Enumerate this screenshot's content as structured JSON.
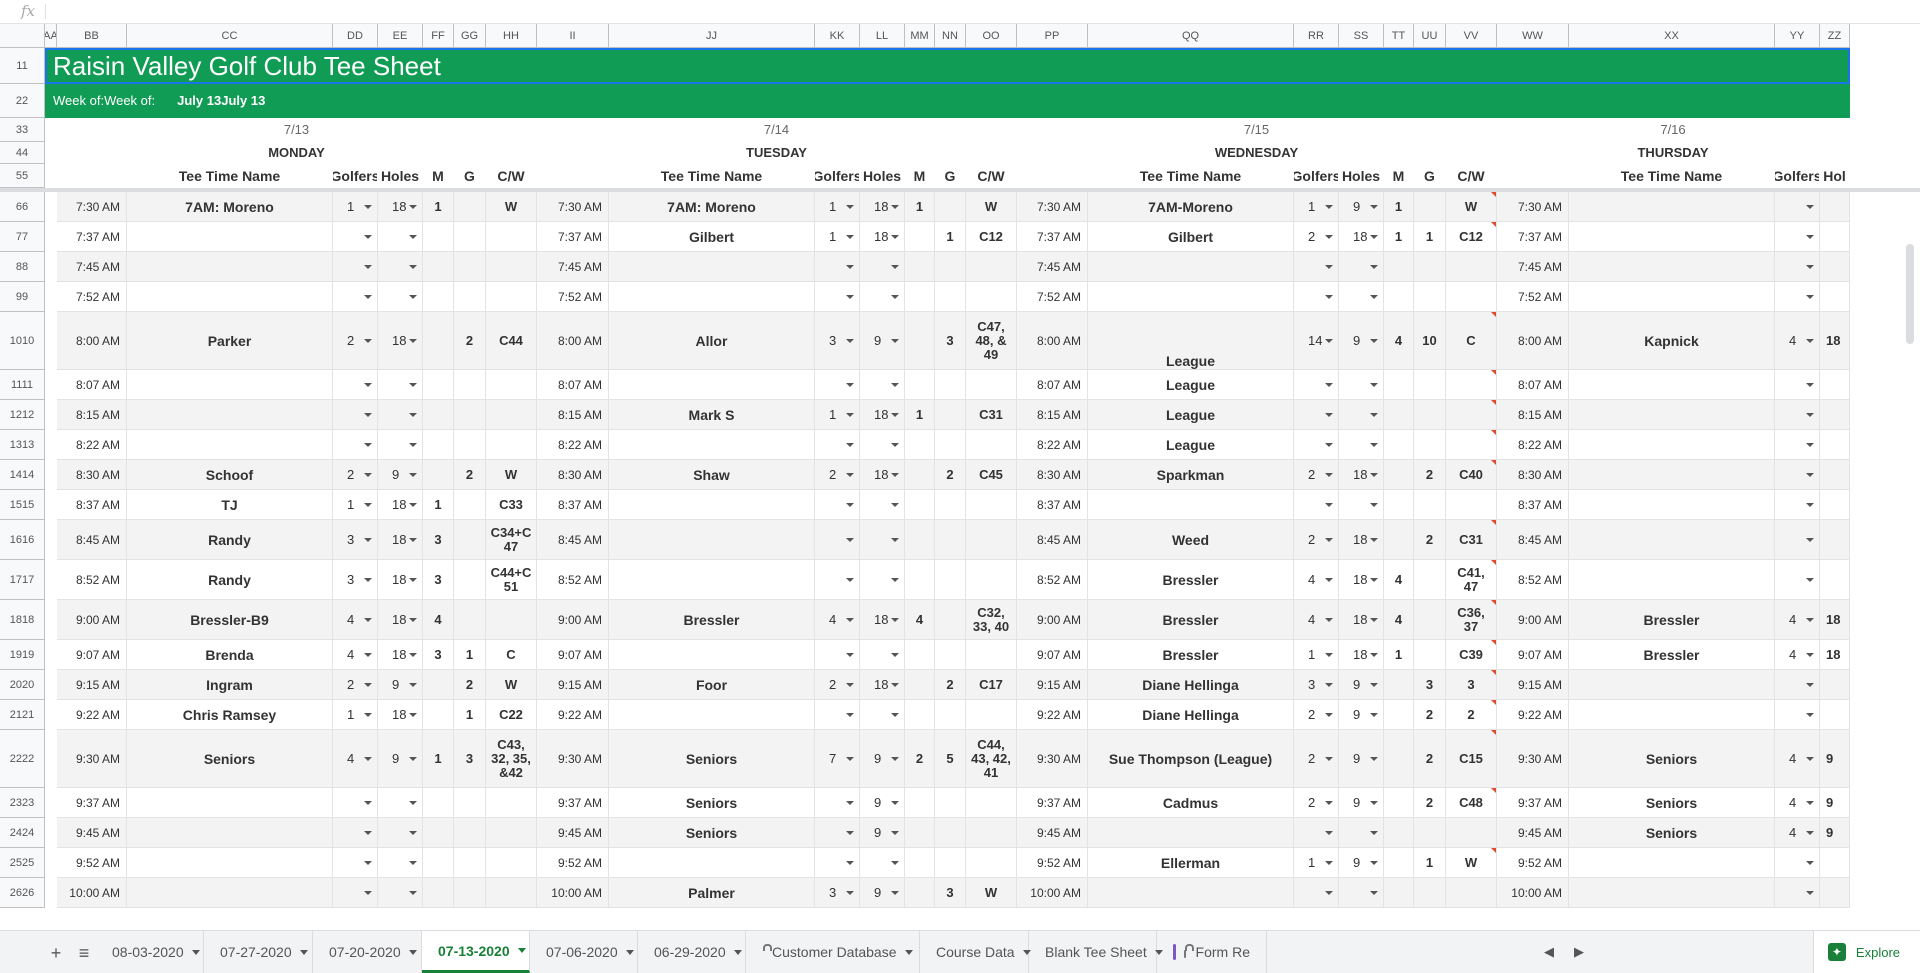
{
  "formula_bar": {
    "fx_label": "fx"
  },
  "columns": [
    "",
    "A",
    "B",
    "C",
    "D",
    "E",
    "F",
    "G",
    "H",
    "I",
    "J",
    "K",
    "L",
    "M",
    "N",
    "O",
    "P",
    "Q",
    "R",
    "S",
    "T",
    "U",
    "V",
    "W",
    "X",
    "Y",
    "Z"
  ],
  "rows": [
    1,
    2,
    3,
    4,
    5,
    6,
    7,
    8,
    9,
    10,
    11,
    12,
    13,
    14,
    15,
    16,
    17,
    18,
    19,
    20,
    21,
    22,
    23,
    24,
    25,
    26
  ],
  "sheet": {
    "title": "Raisin Valley Golf Club Tee Sheet",
    "week_of_label": "Week of:",
    "week_of_value": "July 13",
    "header_color": "#119c55",
    "days": [
      {
        "date": "7/13",
        "name": "MONDAY"
      },
      {
        "date": "7/14",
        "name": "TUESDAY"
      },
      {
        "date": "7/15",
        "name": "WEDNESDAY"
      },
      {
        "date": "7/16",
        "name": "THURSDAY"
      }
    ],
    "col_labels": {
      "name": "Tee Time Name",
      "golfers": "Golfers",
      "holes": "Holes",
      "m": "M",
      "g": "G",
      "cw": "C/W",
      "holes_cut": "Hol"
    }
  },
  "times": [
    "7:30 AM",
    "7:37 AM",
    "7:45 AM",
    "7:52 AM",
    "8:00 AM",
    "8:07 AM",
    "8:15 AM",
    "8:22 AM",
    "8:30 AM",
    "8:37 AM",
    "8:45 AM",
    "8:52 AM",
    "9:00 AM",
    "9:07 AM",
    "9:15 AM",
    "9:22 AM",
    "9:30 AM",
    "9:37 AM",
    "9:45 AM",
    "9:52 AM",
    "10:00 AM"
  ],
  "schedule": {
    "monday": [
      [
        "7AM: Moreno",
        "1",
        "18",
        "1",
        "",
        "W"
      ],
      [
        "",
        "",
        "",
        "",
        "",
        ""
      ],
      [
        "",
        "",
        "",
        "",
        "",
        ""
      ],
      [
        "",
        "",
        "",
        "",
        "",
        ""
      ],
      [
        "Parker",
        "2",
        "18",
        "",
        "2",
        "C44"
      ],
      [
        "",
        "",
        "",
        "",
        "",
        ""
      ],
      [
        "",
        "",
        "",
        "",
        "",
        ""
      ],
      [
        "",
        "",
        "",
        "",
        "",
        ""
      ],
      [
        "Schoof",
        "2",
        "9",
        "",
        "2",
        "W"
      ],
      [
        "TJ",
        "1",
        "18",
        "1",
        "",
        "C33"
      ],
      [
        "Randy",
        "3",
        "18",
        "3",
        "",
        "C34+C 47"
      ],
      [
        "Randy",
        "3",
        "18",
        "3",
        "",
        "C44+C 51"
      ],
      [
        "Bressler-B9",
        "4",
        "18",
        "4",
        "",
        ""
      ],
      [
        "Brenda",
        "4",
        "18",
        "3",
        "1",
        "C"
      ],
      [
        "Ingram",
        "2",
        "9",
        "",
        "2",
        "W"
      ],
      [
        "Chris Ramsey",
        "1",
        "18",
        "",
        "1",
        "C22"
      ],
      [
        "Seniors",
        "4",
        "9",
        "1",
        "3",
        "C43, 32, 35, &42"
      ],
      [
        "",
        "",
        "",
        "",
        "",
        ""
      ],
      [
        "",
        "",
        "",
        "",
        "",
        ""
      ],
      [
        "",
        "",
        "",
        "",
        "",
        ""
      ],
      [
        "",
        "",
        "",
        "",
        "",
        ""
      ]
    ],
    "tuesday": [
      [
        "7AM: Moreno",
        "1",
        "18",
        "1",
        "",
        "W"
      ],
      [
        "Gilbert",
        "1",
        "18",
        "",
        "1",
        "C12"
      ],
      [
        "",
        "",
        "",
        "",
        "",
        ""
      ],
      [
        "",
        "",
        "",
        "",
        "",
        ""
      ],
      [
        "Allor",
        "3",
        "9",
        "",
        "3",
        "C47, 48, & 49"
      ],
      [
        "",
        "",
        "",
        "",
        "",
        ""
      ],
      [
        "Mark S",
        "1",
        "18",
        "1",
        "",
        "C31"
      ],
      [
        "",
        "",
        "",
        "",
        "",
        ""
      ],
      [
        "Shaw",
        "2",
        "18",
        "",
        "2",
        "C45"
      ],
      [
        "",
        "",
        "",
        "",
        "",
        ""
      ],
      [
        "",
        "",
        "",
        "",
        "",
        ""
      ],
      [
        "",
        "",
        "",
        "",
        "",
        ""
      ],
      [
        "Bressler",
        "4",
        "18",
        "4",
        "",
        "C32, 33, 40"
      ],
      [
        "",
        "",
        "",
        "",
        "",
        ""
      ],
      [
        "Foor",
        "2",
        "18",
        "",
        "2",
        "C17"
      ],
      [
        "",
        "",
        "",
        "",
        "",
        ""
      ],
      [
        "Seniors",
        "7",
        "9",
        "2",
        "5",
        "C44, 43, 42, 41"
      ],
      [
        "Seniors",
        "",
        "9",
        "",
        "",
        ""
      ],
      [
        "Seniors",
        "",
        "9",
        "",
        "",
        ""
      ],
      [
        "",
        "",
        "",
        "",
        "",
        ""
      ],
      [
        "Palmer",
        "3",
        "9",
        "",
        "3",
        "W"
      ]
    ],
    "wednesday": [
      [
        "7AM-Moreno",
        "1",
        "9",
        "1",
        "",
        "W"
      ],
      [
        "Gilbert",
        "2",
        "18",
        "1",
        "1",
        "C12"
      ],
      [
        "",
        "",
        "",
        "",
        "",
        ""
      ],
      [
        "",
        "",
        "",
        "",
        "",
        ""
      ],
      [
        "League",
        "14",
        "9",
        "4",
        "10",
        "C"
      ],
      [
        "League",
        "",
        "",
        "",
        "",
        ""
      ],
      [
        "League",
        "",
        "",
        "",
        "",
        ""
      ],
      [
        "League",
        "",
        "",
        "",
        "",
        ""
      ],
      [
        "Sparkman",
        "2",
        "18",
        "",
        "2",
        "C40"
      ],
      [
        "",
        "",
        "",
        "",
        "",
        ""
      ],
      [
        "Weed",
        "2",
        "18",
        "",
        "2",
        "C31"
      ],
      [
        "Bressler",
        "4",
        "18",
        "4",
        "",
        "C41, 47"
      ],
      [
        "Bressler",
        "4",
        "18",
        "4",
        "",
        "C36, 37"
      ],
      [
        "Bressler",
        "1",
        "18",
        "1",
        "",
        "C39"
      ],
      [
        "Diane Hellinga",
        "3",
        "9",
        "",
        "3",
        "3"
      ],
      [
        "Diane Hellinga",
        "2",
        "9",
        "",
        "2",
        "2"
      ],
      [
        "Sue Thompson (League)",
        "2",
        "9",
        "",
        "2",
        "C15"
      ],
      [
        "Cadmus",
        "2",
        "9",
        "",
        "2",
        "C48"
      ],
      [
        "",
        "",
        "",
        "",
        "",
        ""
      ],
      [
        "Ellerman",
        "1",
        "9",
        "",
        "1",
        "W"
      ],
      [
        "",
        "",
        "",
        "",
        "",
        ""
      ]
    ],
    "thursday": [
      [
        "",
        "",
        ""
      ],
      [
        "",
        "",
        ""
      ],
      [
        "",
        "",
        ""
      ],
      [
        "",
        "",
        ""
      ],
      [
        "Kapnick",
        "4",
        "18"
      ],
      [
        "",
        "",
        ""
      ],
      [
        "",
        "",
        ""
      ],
      [
        "",
        "",
        ""
      ],
      [
        "",
        "",
        ""
      ],
      [
        "",
        "",
        ""
      ],
      [
        "",
        "",
        ""
      ],
      [
        "",
        "",
        ""
      ],
      [
        "Bressler",
        "4",
        "18"
      ],
      [
        "Bressler",
        "4",
        "18"
      ],
      [
        "",
        "",
        ""
      ],
      [
        "",
        "",
        ""
      ],
      [
        "Seniors",
        "4",
        "9"
      ],
      [
        "Seniors",
        "4",
        "9"
      ],
      [
        "Seniors",
        "4",
        "9"
      ],
      [
        "",
        "",
        ""
      ],
      [
        "",
        "",
        ""
      ]
    ]
  },
  "sheet_tabs": [
    {
      "label": "08-03-2020",
      "active": false
    },
    {
      "label": "07-27-2020",
      "active": false
    },
    {
      "label": "07-20-2020",
      "active": false
    },
    {
      "label": "07-13-2020",
      "active": true
    },
    {
      "label": "07-06-2020",
      "active": false
    },
    {
      "label": "06-29-2020",
      "active": false
    },
    {
      "label": "Customer Database",
      "active": false,
      "icon": "lock-icon"
    },
    {
      "label": "Course Data",
      "active": false
    },
    {
      "label": "Blank Tee Sheet",
      "active": false
    },
    {
      "label": "Form Re",
      "active": false,
      "icon": "form-lock-icon"
    }
  ],
  "toolbar": {
    "add_sheet": "+",
    "all_sheets": "≡",
    "explore_label": "Explore"
  }
}
